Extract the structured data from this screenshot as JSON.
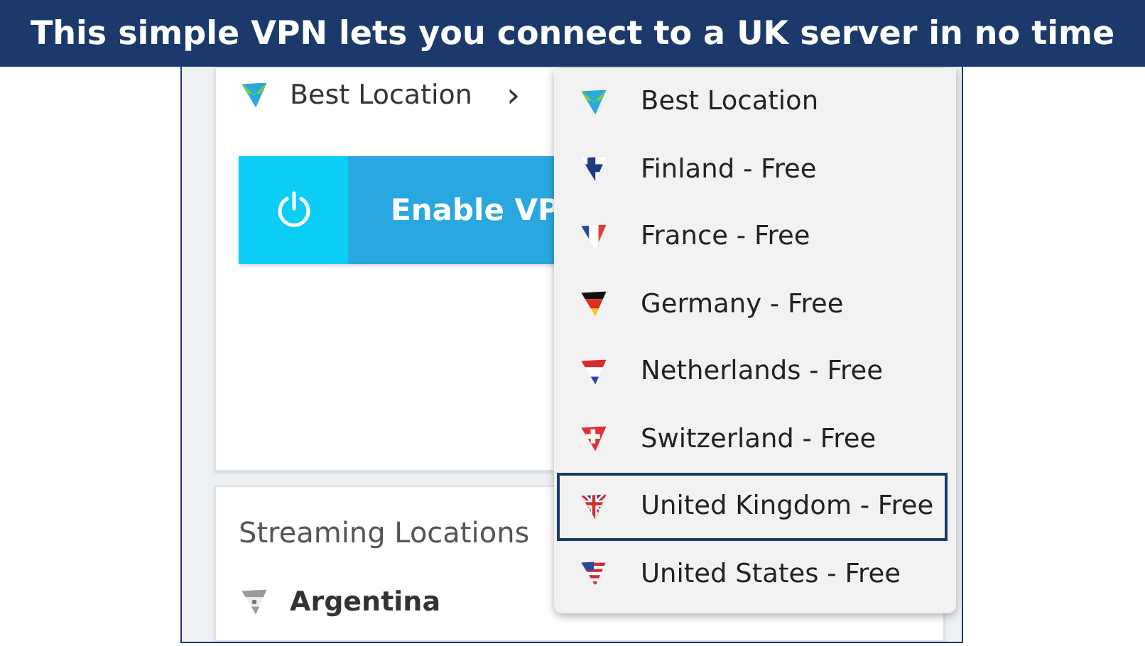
{
  "caption": "This simple VPN lets you connect to a UK server in no time",
  "location_selector": {
    "label": "Best Location",
    "chevron": "›"
  },
  "enable_button": {
    "label": "Enable VP"
  },
  "streaming": {
    "title": "Streaming Locations",
    "items": [
      {
        "label": "Argentina",
        "kind": "ar"
      }
    ]
  },
  "dropdown": {
    "items": [
      {
        "label": "Best Location",
        "kind": "best",
        "selected": false
      },
      {
        "label": "Finland - Free",
        "kind": "fi",
        "selected": false
      },
      {
        "label": "France - Free",
        "kind": "fr",
        "selected": false
      },
      {
        "label": "Germany - Free",
        "kind": "de",
        "selected": false
      },
      {
        "label": "Netherlands - Free",
        "kind": "nl",
        "selected": false
      },
      {
        "label": "Switzerland - Free",
        "kind": "ch",
        "selected": false
      },
      {
        "label": "United Kingdom - Free",
        "kind": "uk",
        "selected": true
      },
      {
        "label": "United States - Free",
        "kind": "us",
        "selected": false
      }
    ]
  }
}
